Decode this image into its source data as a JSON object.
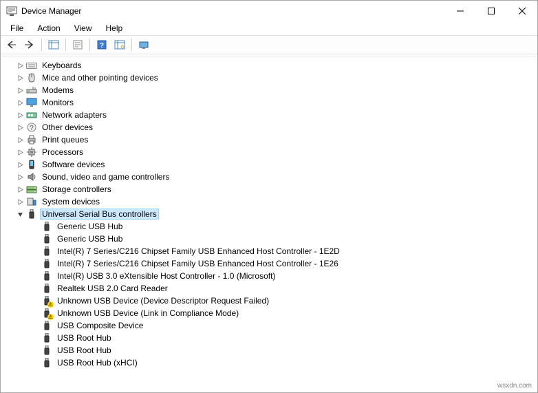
{
  "window": {
    "title": "Device Manager"
  },
  "menubar": [
    "File",
    "Action",
    "View",
    "Help"
  ],
  "tree": {
    "categories": [
      {
        "label": "Keyboards",
        "icon": "keyboard-icon",
        "expanded": false
      },
      {
        "label": "Mice and other pointing devices",
        "icon": "mouse-icon",
        "expanded": false
      },
      {
        "label": "Modems",
        "icon": "modem-icon",
        "expanded": false
      },
      {
        "label": "Monitors",
        "icon": "monitor-icon",
        "expanded": false
      },
      {
        "label": "Network adapters",
        "icon": "network-icon",
        "expanded": false
      },
      {
        "label": "Other devices",
        "icon": "other-icon",
        "expanded": false
      },
      {
        "label": "Print queues",
        "icon": "printer-icon",
        "expanded": false
      },
      {
        "label": "Processors",
        "icon": "cpu-icon",
        "expanded": false
      },
      {
        "label": "Software devices",
        "icon": "software-icon",
        "expanded": false
      },
      {
        "label": "Sound, video and game controllers",
        "icon": "sound-icon",
        "expanded": false
      },
      {
        "label": "Storage controllers",
        "icon": "storage-icon",
        "expanded": false
      },
      {
        "label": "System devices",
        "icon": "system-icon",
        "expanded": false
      },
      {
        "label": "Universal Serial Bus controllers",
        "icon": "usb-icon",
        "expanded": true,
        "selected": true,
        "children": [
          {
            "label": "Generic USB Hub",
            "icon": "usb-icon",
            "warn": false
          },
          {
            "label": "Generic USB Hub",
            "icon": "usb-icon",
            "warn": false
          },
          {
            "label": "Intel(R) 7 Series/C216 Chipset Family USB Enhanced Host Controller - 1E2D",
            "icon": "usb-icon",
            "warn": false
          },
          {
            "label": "Intel(R) 7 Series/C216 Chipset Family USB Enhanced Host Controller - 1E26",
            "icon": "usb-icon",
            "warn": false
          },
          {
            "label": "Intel(R) USB 3.0 eXtensible Host Controller - 1.0 (Microsoft)",
            "icon": "usb-icon",
            "warn": false
          },
          {
            "label": "Realtek USB 2.0 Card Reader",
            "icon": "usb-icon",
            "warn": false
          },
          {
            "label": "Unknown USB Device (Device Descriptor Request Failed)",
            "icon": "usb-icon",
            "warn": true
          },
          {
            "label": "Unknown USB Device (Link in Compliance Mode)",
            "icon": "usb-icon",
            "warn": true
          },
          {
            "label": "USB Composite Device",
            "icon": "usb-icon",
            "warn": false
          },
          {
            "label": "USB Root Hub",
            "icon": "usb-icon",
            "warn": false
          },
          {
            "label": "USB Root Hub",
            "icon": "usb-icon",
            "warn": false
          },
          {
            "label": "USB Root Hub (xHCI)",
            "icon": "usb-icon",
            "warn": false
          }
        ]
      }
    ]
  },
  "footer": {
    "watermark": "wsxdn.com"
  }
}
